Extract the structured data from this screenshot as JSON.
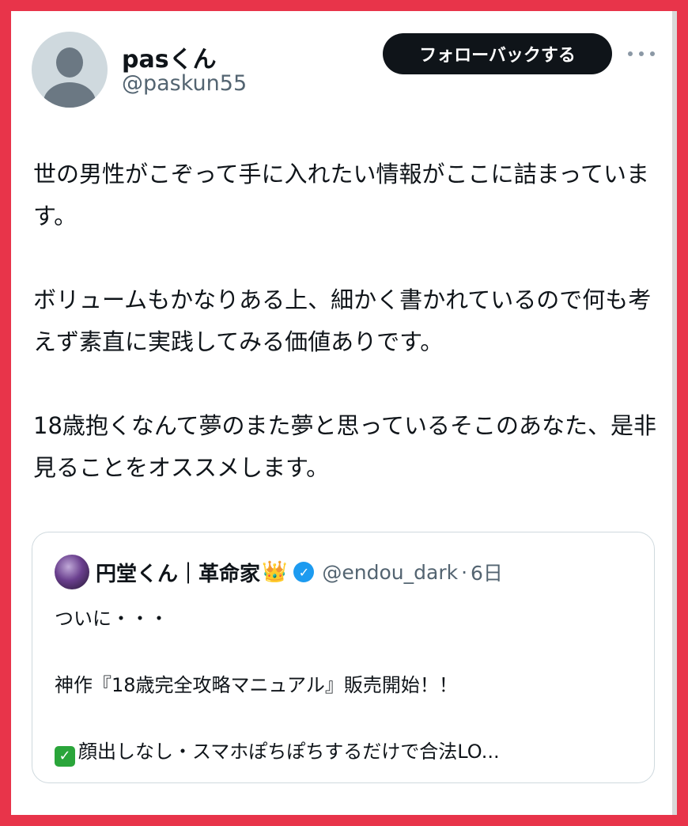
{
  "author": {
    "display_name": "pasくん",
    "handle": "@paskun55"
  },
  "follow_button_label": "フォローバックする",
  "more_icon": "more-horizontal-icon",
  "tweet": {
    "paragraph_1": "世の男性がこぞって手に入れたい情報がここに詰まっています。",
    "paragraph_2": "ボリュームもかなりある上、細かく書かれているので何も考えず素直に実践してみる価値ありです。",
    "paragraph_3": "18歳抱くなんて夢のまた夢と思っているそこのあなた、是非見ることをオススメします。"
  },
  "quote": {
    "display_name": "円堂くん｜革命家",
    "crown_emoji": "👑",
    "verified_icon": "verified-badge-icon",
    "handle": "@endou_dark",
    "separator": "·",
    "time": "6日",
    "line_1": "ついに・・・",
    "line_2": "神作『18歳完全攻略マニュアル』販売開始！！",
    "check_emoji": "✓",
    "line_3": "顔出しなし・スマホぽちぽちするだけで合法LO..."
  },
  "colors": {
    "frame": "#e8344a",
    "text_primary": "#0f1419",
    "text_secondary": "#536471",
    "button_bg": "#0f1419",
    "verified": "#1d9bf0"
  }
}
